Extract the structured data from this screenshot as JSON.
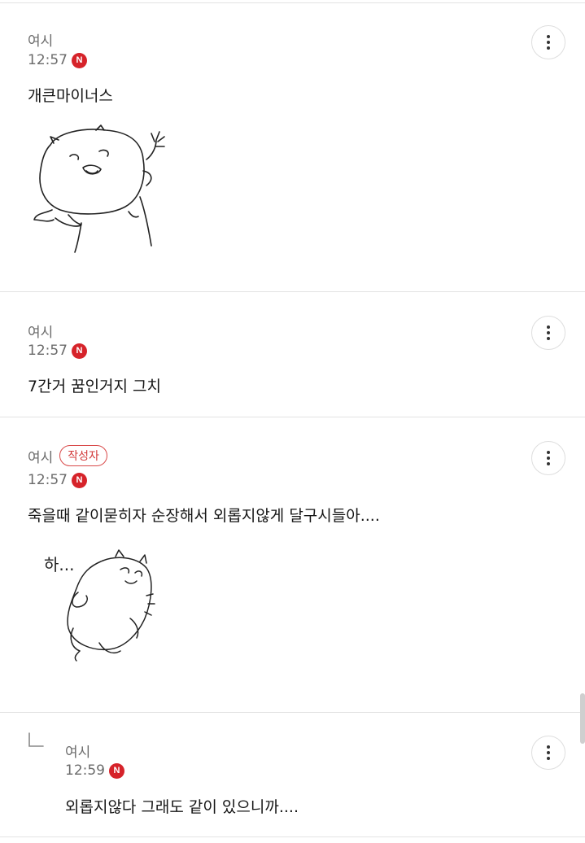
{
  "comments": [
    {
      "author": "여시",
      "time": "12:57",
      "new_badge": "N",
      "text": "개큰마이너스",
      "sticker": "hamster-waving-sticker",
      "is_writer": false
    },
    {
      "author": "여시",
      "time": "12:57",
      "new_badge": "N",
      "text": "7간거 꿈인거지 그치",
      "sticker": null,
      "is_writer": false
    },
    {
      "author": "여시",
      "writer_label": "작성자",
      "time": "12:57",
      "new_badge": "N",
      "text": "죽을때 같이묻히자 순장해서 외롭지않게 달구시들아....",
      "sticker": "hamster-lying-sticker",
      "sticker_caption": "하...",
      "is_writer": true
    },
    {
      "author": "여시",
      "time": "12:59",
      "new_badge": "N",
      "text": "외롭지않다 그래도 같이 있으니까....",
      "sticker": null,
      "is_writer": false,
      "is_reply": true
    }
  ],
  "colors": {
    "new_badge": "#d6232a",
    "writer_badge": "#d94a4a",
    "divider": "#e3e3e3",
    "meta_text": "#6b6b6b"
  },
  "icons": {
    "more": "more-vertical-icon",
    "reply": "reply-arrow-icon"
  }
}
